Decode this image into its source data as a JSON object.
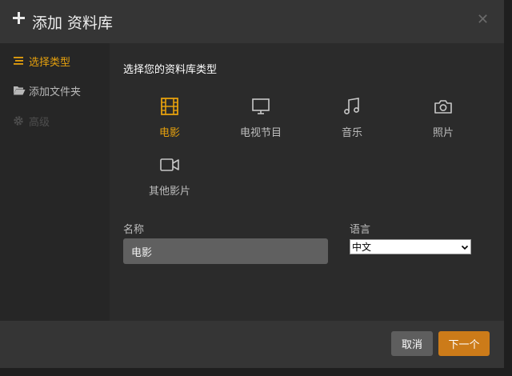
{
  "header": {
    "title": "添加 资料库",
    "plus_icon": "plus-icon",
    "close_icon": "close-icon",
    "close_glyph": "✕"
  },
  "sidebar": {
    "items": [
      {
        "label": "选择类型",
        "icon": "list-icon",
        "state": "active"
      },
      {
        "label": "添加文件夹",
        "icon": "folder-open-icon",
        "state": "normal"
      },
      {
        "label": "高级",
        "icon": "gear-icon",
        "state": "disabled"
      }
    ]
  },
  "main": {
    "section_title": "选择您的资料库类型",
    "library_types": [
      {
        "label": "电影",
        "icon": "film-icon",
        "selected": true
      },
      {
        "label": "电视节目",
        "icon": "tv-icon",
        "selected": false
      },
      {
        "label": "音乐",
        "icon": "music-note-icon",
        "selected": false
      },
      {
        "label": "照片",
        "icon": "camera-icon",
        "selected": false
      },
      {
        "label": "其他影片",
        "icon": "video-camera-icon",
        "selected": false
      }
    ],
    "name_label": "名称",
    "name_value": "电影",
    "language_label": "语言",
    "language_value": "中文"
  },
  "footer": {
    "cancel_label": "取消",
    "next_label": "下一个"
  },
  "colors": {
    "accent": "#e5a00d",
    "next_button": "#cc7b19",
    "cancel_button": "#5e5e5e"
  }
}
